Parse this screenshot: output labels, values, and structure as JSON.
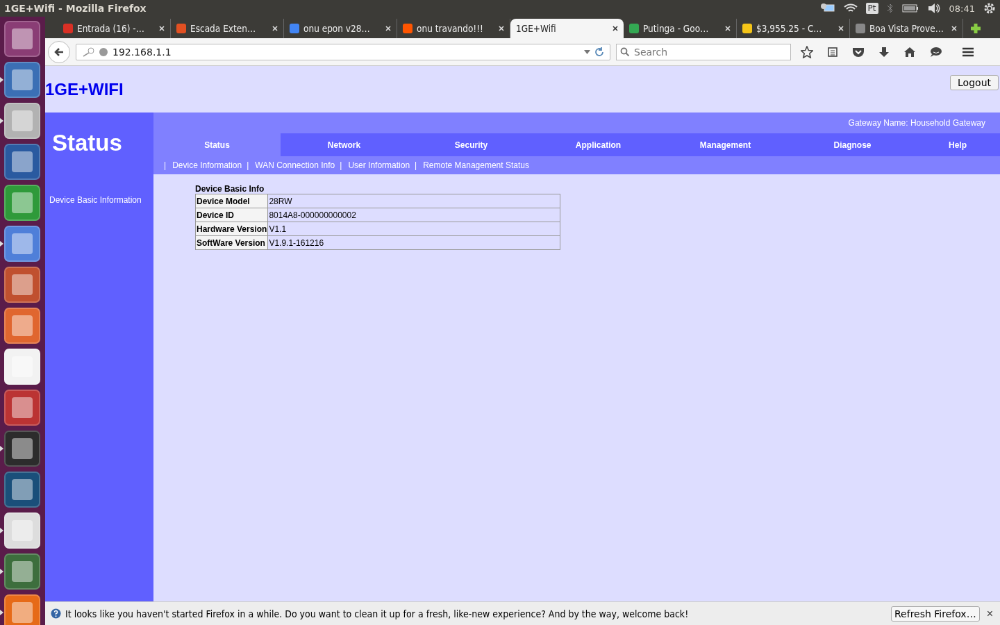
{
  "window": {
    "title": "1GE+Wifi - Mozilla Firefox"
  },
  "system_tray": {
    "language": "Pt",
    "time": "08:41"
  },
  "launcher": [
    {
      "running": false
    },
    {
      "running": true
    },
    {
      "running": true
    },
    {
      "running": false
    },
    {
      "running": false
    },
    {
      "running": true
    },
    {
      "running": false
    },
    {
      "running": false
    },
    {
      "running": false
    },
    {
      "running": false
    },
    {
      "running": true
    },
    {
      "running": false
    },
    {
      "running": true
    },
    {
      "running": true
    },
    {
      "running": true
    }
  ],
  "browser_tabs": [
    {
      "label": "Entrada (16) -…",
      "selected": false
    },
    {
      "label": "Escada Exten…",
      "selected": false
    },
    {
      "label": "onu epon v28…",
      "selected": false
    },
    {
      "label": "onu travando!!!",
      "selected": false
    },
    {
      "label": "1GE+Wifi",
      "selected": true
    },
    {
      "label": "Putinga - Goo…",
      "selected": false
    },
    {
      "label": "$3,955.25 - C…",
      "selected": false
    },
    {
      "label": "Boa Vista Prove…",
      "selected": false
    }
  ],
  "address_bar": {
    "value": "192.168.1.1"
  },
  "search": {
    "placeholder": "Search"
  },
  "page": {
    "logo": "1GE+WIFI",
    "logout": "Logout",
    "section_title": "Status",
    "gateway_name": "Gateway Name: Household Gateway",
    "side_menu": [
      "Device Basic Information"
    ],
    "menu": [
      {
        "label": "Status",
        "selected": true
      },
      {
        "label": "Network",
        "selected": false
      },
      {
        "label": "Security",
        "selected": false
      },
      {
        "label": "Application",
        "selected": false
      },
      {
        "label": "Management",
        "selected": false
      },
      {
        "label": "Diagnose",
        "selected": false
      },
      {
        "label": "Help",
        "selected": false
      }
    ],
    "separator": "|",
    "submenu": [
      "Device Information",
      "WAN Connection Info",
      "User Information",
      "Remote Management Status"
    ],
    "table": {
      "title": "Device Basic Info",
      "rows": [
        {
          "label": "Device Model",
          "value": "28RW"
        },
        {
          "label": "Device ID",
          "value": "8014A8-000000000002"
        },
        {
          "label": "Hardware Version",
          "value": "V1.1"
        },
        {
          "label": "SoftWare Version",
          "value": "V1.9.1-161216"
        }
      ]
    }
  },
  "notification": {
    "message": "It looks like you haven't started Firefox in a while. Do you want to clean it up for a fresh, like-new experience? And by the way, welcome back!",
    "button": "Refresh Firefox…",
    "close": "×"
  }
}
